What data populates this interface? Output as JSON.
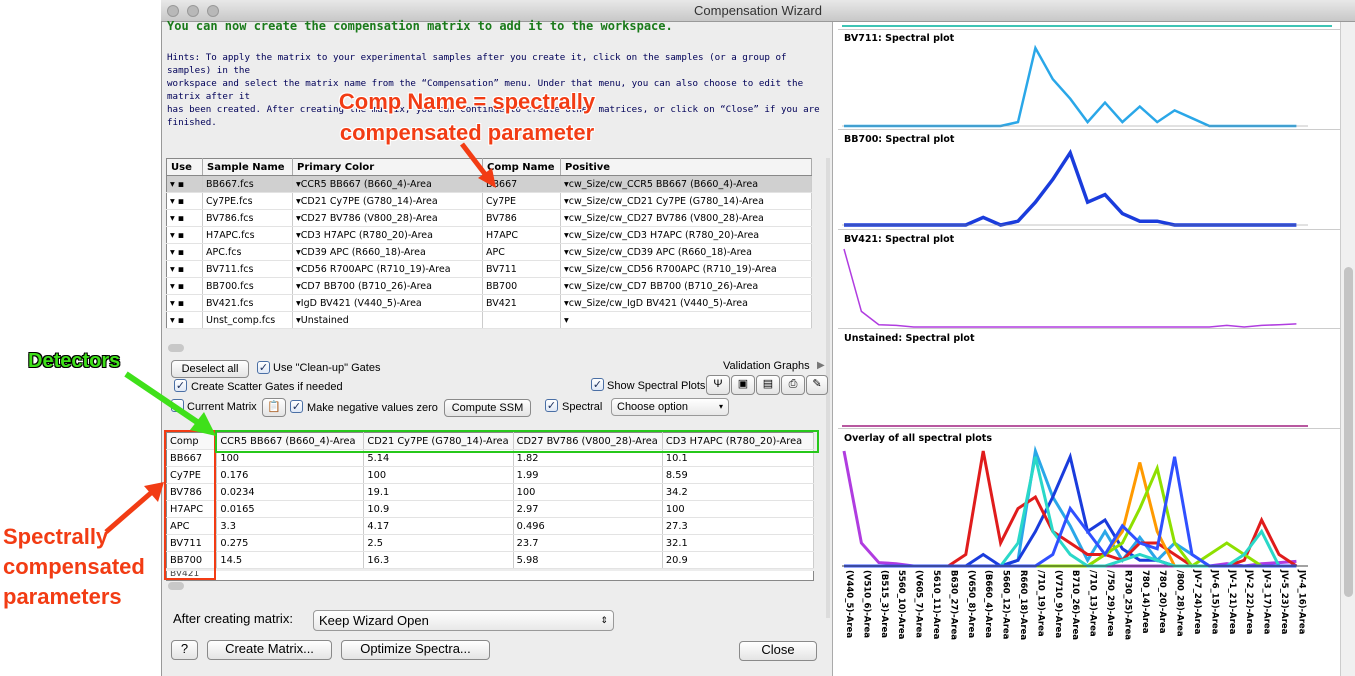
{
  "window": {
    "title": "Compensation Wizard"
  },
  "headline": "You can now create the compensation matrix to add it to the workspace.",
  "hints": [
    "Hints: To apply the matrix to your experimental samples after you create it, click on the samples (or a group of samples) in the",
    "workspace and select the matrix name from the “Compensation” menu. Under that menu, you can also choose to edit the matrix after it",
    "has been created. After creating the matrix, you can continue to create other matrices, or click on “Close” if you are finished."
  ],
  "annotations": {
    "comp_name": [
      "Comp Name = spectrally",
      "compensated parameter"
    ],
    "detectors": "Detectors",
    "spectral_params": [
      "Spectrally",
      "compensated",
      "parameters"
    ]
  },
  "sample_table": {
    "headers": [
      "Use",
      "Sample Name",
      "Primary Color",
      "Comp Name",
      "Positive"
    ],
    "rows": [
      {
        "sample": "BB667.fcs",
        "primary": "CCR5 BB667 (B660_4)-Area",
        "comp": "BB667",
        "positive": "cw_Size/cw_CCR5 BB667 (B660_4)-Area"
      },
      {
        "sample": "Cy7PE.fcs",
        "primary": "CD21 Cy7PE (G780_14)-Area",
        "comp": "Cy7PE",
        "positive": "cw_Size/cw_CD21 Cy7PE (G780_14)-Area"
      },
      {
        "sample": "BV786.fcs",
        "primary": "CD27 BV786 (V800_28)-Area",
        "comp": "BV786",
        "positive": "cw_Size/cw_CD27 BV786 (V800_28)-Area"
      },
      {
        "sample": "H7APC.fcs",
        "primary": "CD3 H7APC (R780_20)-Area",
        "comp": "H7APC",
        "positive": "cw_Size/cw_CD3 H7APC (R780_20)-Area"
      },
      {
        "sample": "APC.fcs",
        "primary": "CD39 APC (R660_18)-Area",
        "comp": "APC",
        "positive": "cw_Size/cw_CD39 APC (R660_18)-Area"
      },
      {
        "sample": "BV711.fcs",
        "primary": "CD56 R700APC (R710_19)-Area",
        "comp": "BV711",
        "positive": "cw_Size/cw_CD56 R700APC (R710_19)-Area"
      },
      {
        "sample": "BB700.fcs",
        "primary": "CD7 BB700 (B710_26)-Area",
        "comp": "BB700",
        "positive": "cw_Size/cw_CD7 BB700 (B710_26)-Area"
      },
      {
        "sample": "BV421.fcs",
        "primary": "IgD BV421 (V440_5)-Area",
        "comp": "BV421",
        "positive": "cw_Size/cw_IgD BV421 (V440_5)-Area"
      },
      {
        "sample": "Unst_comp.fcs",
        "primary": "Unstained",
        "comp": "",
        "positive": ""
      }
    ]
  },
  "controls": {
    "deselect_all": "Deselect all",
    "use_cleanup": "Use \"Clean-up\" Gates",
    "scatter_gates": "Create Scatter Gates if needed",
    "current_matrix": "Current Matrix",
    "negative_zero": "Make negative values zero",
    "compute_ssm": "Compute SSM",
    "spectral": "Spectral",
    "choose_option": "Choose option",
    "validation_graphs": "Validation Graphs",
    "show_spectral_plots": "Show Spectral Plots"
  },
  "comp_table": {
    "corner": "Comp",
    "columns": [
      "CCR5 BB667 (B660_4)-Area",
      "CD21 Cy7PE (G780_14)-Area",
      "CD27 BV786 (V800_28)-Area",
      "CD3 H7APC (R780_20)-Area"
    ],
    "rows": [
      {
        "name": "BB667",
        "values": [
          "100",
          "5.14",
          "1.82",
          "10.1"
        ]
      },
      {
        "name": "Cy7PE",
        "values": [
          "0.176",
          "100",
          "1.99",
          "8.59"
        ]
      },
      {
        "name": "BV786",
        "values": [
          "0.0234",
          "19.1",
          "100",
          "34.2"
        ]
      },
      {
        "name": "H7APC",
        "values": [
          "0.0165",
          "10.9",
          "2.97",
          "100"
        ]
      },
      {
        "name": "APC",
        "values": [
          "3.3",
          "4.17",
          "0.496",
          "27.3"
        ]
      },
      {
        "name": "BV711",
        "values": [
          "0.275",
          "2.5",
          "23.7",
          "32.1"
        ]
      },
      {
        "name": "BB700",
        "values": [
          "14.5",
          "16.3",
          "5.98",
          "20.9"
        ]
      }
    ]
  },
  "footer": {
    "after_label": "After creating matrix:",
    "after_value": "Keep Wizard Open",
    "help": "?",
    "create_matrix": "Create Matrix...",
    "optimize": "Optimize Spectra...",
    "close": "Close"
  },
  "plots": [
    {
      "title": "BV711: Spectral plot",
      "color": "#2aa7e8"
    },
    {
      "title": "BB700: Spectral plot",
      "color": "#1a3cdc"
    },
    {
      "title": "BV421: Spectral plot",
      "color": "#b03ce0"
    },
    {
      "title": "Unstained: Spectral plot",
      "color": "#a02080"
    },
    {
      "title": "Overlay of all spectral plots",
      "color": "#000000"
    }
  ],
  "x_axis_labels": [
    "(V440_5)-Area",
    "(V510_6)-Area",
    "(B515_3)-Area",
    "5560_10)-Area",
    "(V605_7)-Area",
    "5610_11)-Area",
    "B630_27)-Area",
    "(V650_8)-Area",
    "(B660_4)-Area",
    "5660_12)-Area",
    "R660_18)-Area",
    "/710_19)-Area",
    "(V710_9)-Area",
    "B710_26)-Area",
    "/710_13)-Area",
    "/750_29)-Area",
    "R730_25)-Area",
    "780_14)-Area",
    "780_20)-Area",
    "/800_28)-Area",
    "JV-7_24)-Area",
    "JV-6_15)-Area",
    "JV-1_21)-Area",
    "JV-2_22)-Area",
    "JV-3_17)-Area",
    "JV-5_23)-Area",
    "JV-4_16)-Area"
  ]
}
